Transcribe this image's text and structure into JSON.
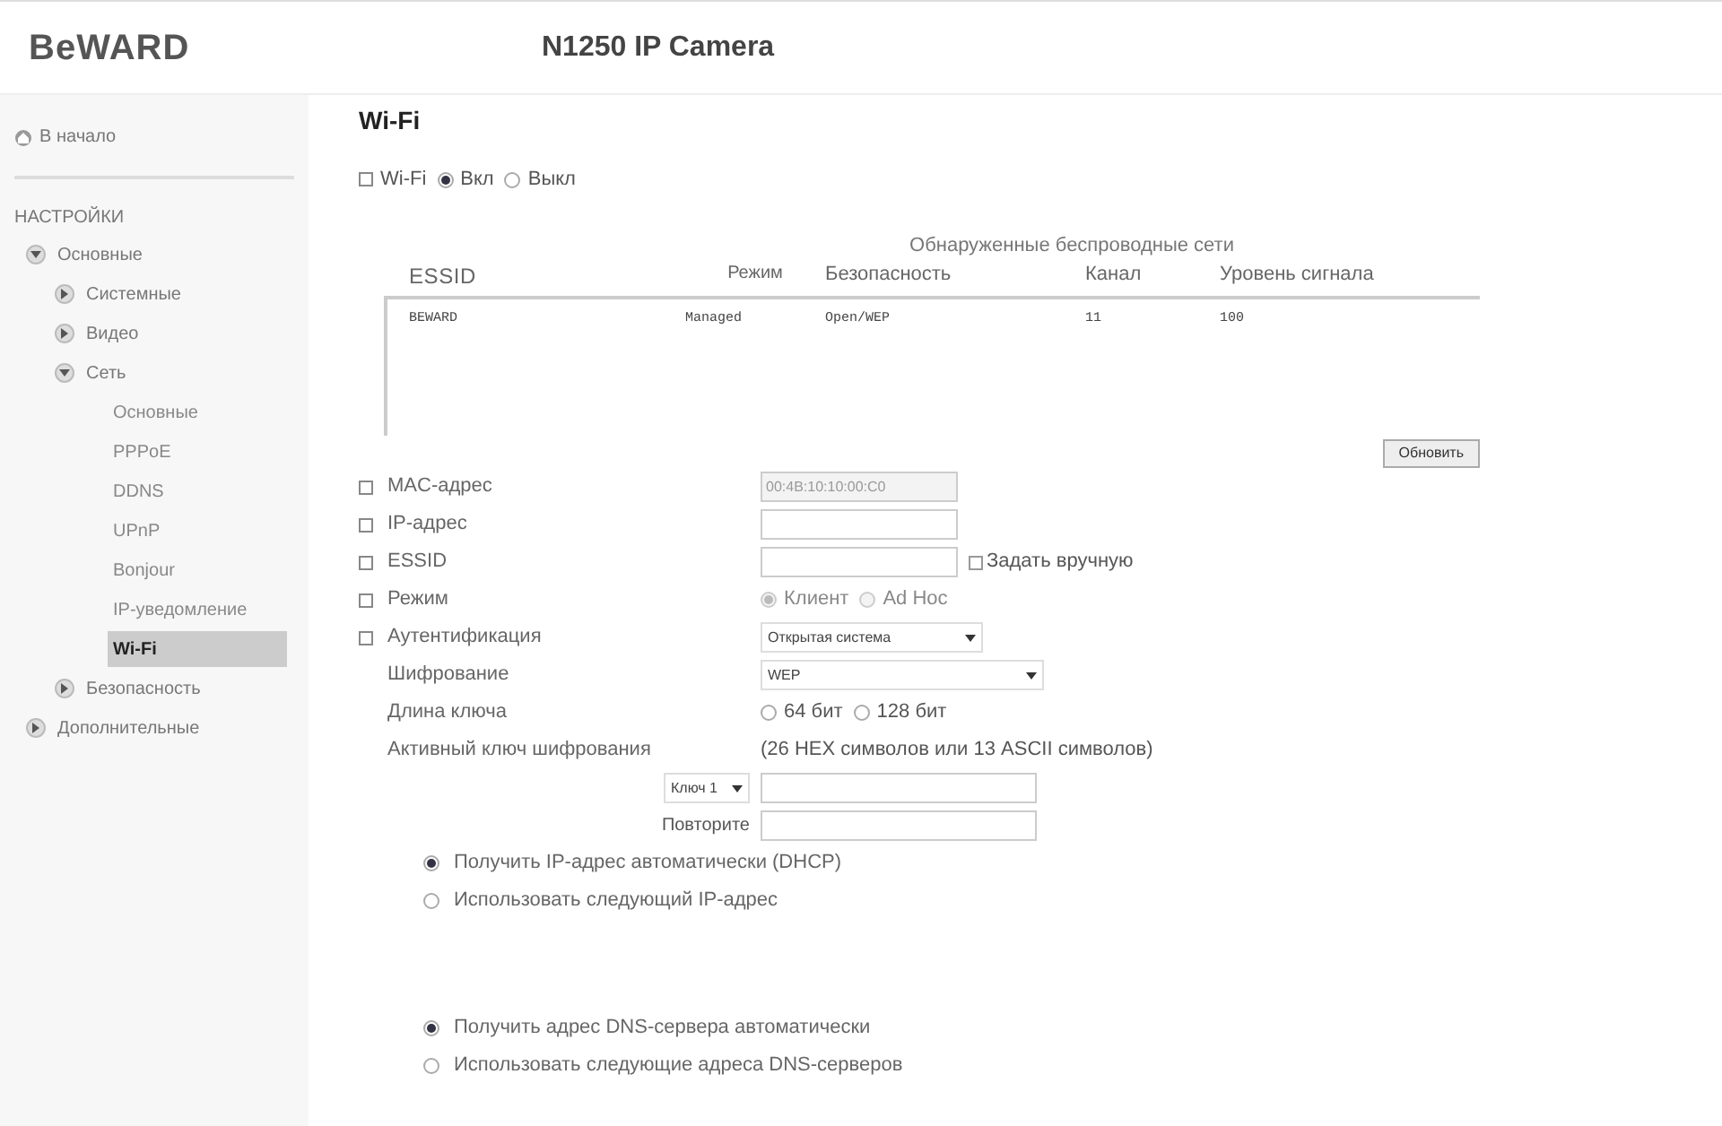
{
  "header": {
    "logo": "BeWARD",
    "title": "N1250 IP Camera"
  },
  "sidebar": {
    "home": "В начало",
    "section": "НАСТРОЙКИ",
    "items": [
      {
        "label": "Основные",
        "expanded": true,
        "children": [
          {
            "label": "Системные",
            "expanded": false
          },
          {
            "label": "Видео",
            "expanded": false
          },
          {
            "label": "Сеть",
            "expanded": true,
            "children": [
              {
                "label": "Основные",
                "selected": false
              },
              {
                "label": "PPPoE",
                "selected": false
              },
              {
                "label": "DDNS",
                "selected": false
              },
              {
                "label": "UPnP",
                "selected": false
              },
              {
                "label": "Bonjour",
                "selected": false
              },
              {
                "label": "IP-уведомление",
                "selected": false
              },
              {
                "label": "Wi-Fi",
                "selected": true
              }
            ]
          },
          {
            "label": "Безопасность",
            "expanded": false
          }
        ]
      },
      {
        "label": "Дополнительные",
        "expanded": false
      }
    ]
  },
  "page_title": "Wi-Fi",
  "wifi": {
    "label": "Wi-Fi",
    "options": [
      {
        "label": "Вкл",
        "selected": true
      },
      {
        "label": "Выкл",
        "selected": false
      }
    ]
  },
  "networks": {
    "caption": "Обнаруженные беспроводные сети",
    "columns": [
      "ESSID",
      "Режим",
      "Безопасность",
      "Канал",
      "Уровень сигнала"
    ],
    "rows": [
      [
        "BEWARD",
        "Managed",
        "Open/WEP",
        "11",
        "100"
      ]
    ],
    "refresh_button": "Обновить"
  },
  "fields": [
    {
      "kind": "input",
      "label": "MAC-адрес",
      "marker": true,
      "value": "00:4B:10:10:00:C0",
      "disabled": true
    },
    {
      "kind": "input",
      "label": "IP-адрес",
      "marker": true,
      "disabled": false
    },
    {
      "kind": "input",
      "label": "ESSID",
      "marker": true,
      "disabled": false,
      "checkbox": {
        "label": "Задать вручную",
        "checked": false
      }
    },
    {
      "kind": "radio",
      "label": "Режим",
      "marker": true,
      "disabled": true,
      "options": [
        {
          "label": "Клиент",
          "selected": true
        },
        {
          "label": "Ad Hoc",
          "selected": false
        }
      ]
    },
    {
      "kind": "select",
      "label": "Аутентификация",
      "marker": true,
      "value": "Открытая система",
      "wide": false
    },
    {
      "kind": "select",
      "label": "Шифрование",
      "marker": false,
      "value": "WEP",
      "wide": true
    },
    {
      "kind": "radio",
      "label": "Длина ключа",
      "marker": false,
      "disabled": false,
      "options": [
        {
          "label": "64 бит",
          "selected": false
        },
        {
          "label": "128 бит",
          "selected": false
        }
      ]
    },
    {
      "kind": "note",
      "label": "Активный ключ шифрования",
      "marker": false,
      "value": "(26 HEX символов или 13 ASCII символов)"
    }
  ],
  "key": {
    "select": "Ключ 1",
    "repeat_label": "Повторите"
  },
  "ip_mode": [
    {
      "label": "Получить IP-адрес автоматически (DHCP)",
      "selected": true
    },
    {
      "label": "Использовать следующий IP-адрес",
      "selected": false
    }
  ],
  "dns_mode": [
    {
      "label": "Получить адрес DNS-сервера автоматически",
      "selected": true
    },
    {
      "label": "Использовать следующие адреса DNS-серверов",
      "selected": false
    }
  ]
}
